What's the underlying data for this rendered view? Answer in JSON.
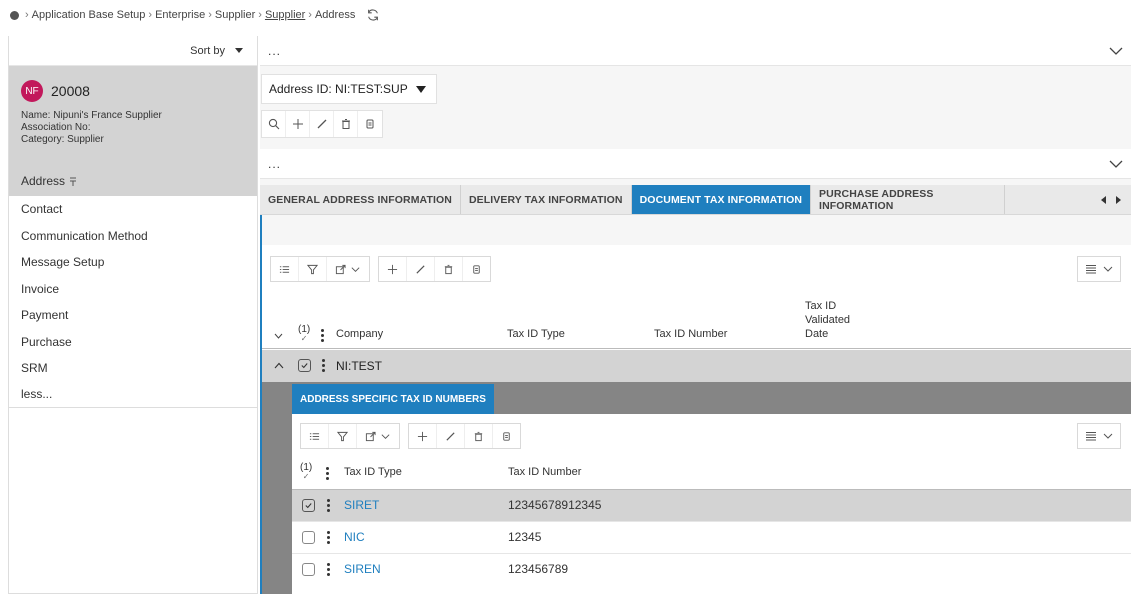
{
  "breadcrumb": {
    "items": [
      "Application Base Setup",
      "Enterprise",
      "Supplier",
      "Supplier",
      "Address"
    ]
  },
  "sidebar": {
    "sort_label": "Sort by",
    "record": {
      "avatar": "NF",
      "id": "20008",
      "name_line": "Name:  Nipuni's France Supplier",
      "association_line": "Association No:",
      "category_line": "Category:  Supplier"
    },
    "active_item": "Address",
    "items": [
      "Contact",
      "Communication Method",
      "Message Setup",
      "Invoice",
      "Payment",
      "Purchase",
      "SRM",
      "less..."
    ]
  },
  "main": {
    "collapse_top": "...",
    "address_select": "Address ID: NI:TEST:SUP",
    "collapse_mid": "...",
    "tabs": [
      "GENERAL ADDRESS INFORMATION",
      "DELIVERY TAX INFORMATION",
      "DOCUMENT TAX INFORMATION",
      "PURCHASE ADDRESS INFORMATION"
    ],
    "active_tab": "DOCUMENT TAX INFORMATION",
    "grid": {
      "selected_count": "(1)",
      "columns": [
        "Company",
        "Tax ID Type",
        "Tax ID Number"
      ],
      "validated_col": [
        "Tax ID",
        "Validated",
        "Date"
      ],
      "row": {
        "company": "NI:TEST"
      }
    },
    "subgrid": {
      "tab": "ADDRESS SPECIFIC TAX ID NUMBERS",
      "selected_count": "(1)",
      "columns": [
        "Tax ID Type",
        "Tax ID Number"
      ],
      "rows": [
        {
          "type": "SIRET",
          "number": "12345678912345",
          "selected": true
        },
        {
          "type": "NIC",
          "number": "12345",
          "selected": false
        },
        {
          "type": "SIREN",
          "number": "123456789",
          "selected": false
        }
      ]
    }
  },
  "colors": {
    "accent": "#1f7fbf",
    "avatar": "#c2185b",
    "selected_row": "#d3d3d3"
  }
}
